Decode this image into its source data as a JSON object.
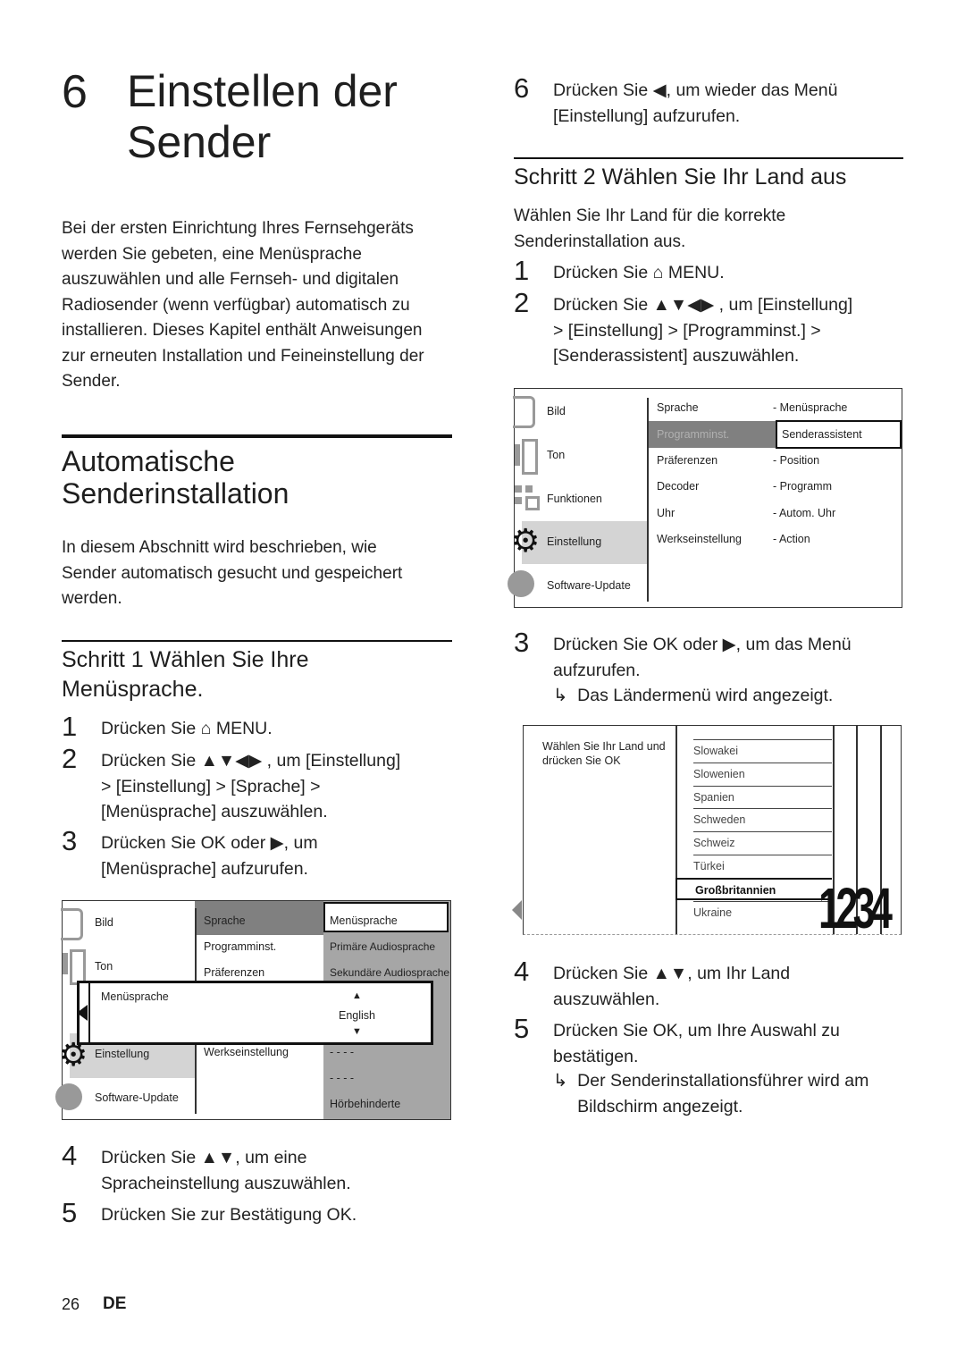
{
  "chapter": {
    "number": "6",
    "title": "Einstellen der\nSender"
  },
  "intro": "Bei der ersten Einrichtung Ihres Fernsehgeräts\nwerden Sie gebeten, eine Menüsprache\nauszuwählen und alle Fernseh- und digitalen\nRadiosender (wenn verfügbar) automatisch zu\ninstallieren. Dieses Kapitel enthält Anweisungen\nzur erneuten Installation und Feineinstellung der\nSender.",
  "section": {
    "title": "Automatische\nSenderinstallation",
    "text": "In diesem Abschnitt wird beschrieben, wie\nSender automatisch gesucht und gespeichert\nwerden."
  },
  "step1": {
    "heading": "Schritt 1 Wählen Sie Ihre\nMenüsprache.",
    "items": [
      {
        "n": "1",
        "text": "Drücken Sie ⌂ MENU."
      },
      {
        "n": "2",
        "text": "Drücken Sie ▲▼◀▶ , um [Einstellung]\n> [Einstellung] > [Sprache] >\n[Menüsprache] auszuwählen."
      },
      {
        "n": "3",
        "text": "Drücken Sie OK oder ▶, um\n[Menüsprache] aufzurufen."
      },
      {
        "n": "4",
        "text": "Drücken Sie ▲▼, um eine\nSpracheinstellung auszuwählen."
      },
      {
        "n": "5",
        "text": "Drücken Sie zur Bestätigung OK."
      }
    ]
  },
  "menu1": {
    "left": [
      "Bild",
      "Ton",
      "Einstellung",
      "Software-Update"
    ],
    "middle": [
      "Sprache",
      "Programminst.",
      "Präferenzen",
      "Werkseinstellung"
    ],
    "right": [
      "Menüsprache",
      "Primäre Audiosprache",
      "Sekundäre Audiosprache",
      "- - - -",
      "- - - -",
      "Hörbehinderte"
    ],
    "popup": {
      "label": "Menüsprache",
      "up": "▲",
      "value": "English",
      "down": "▼"
    }
  },
  "right": {
    "step6": {
      "n": "6",
      "text": "Drücken Sie ◀, um wieder das Menü\n[Einstellung] aufzurufen."
    },
    "heading": "Schritt 2 Wählen Sie Ihr Land aus",
    "text": "Wählen Sie Ihr Land für die korrekte\nSenderinstallation aus.",
    "items": [
      {
        "n": "1",
        "text": "Drücken Sie ⌂ MENU."
      },
      {
        "n": "2",
        "text": "Drücken Sie ▲▼◀▶ , um [Einstellung]\n> [Einstellung] > [Programminst.] >\n[Senderassistent] auszuwählen."
      },
      {
        "n": "3",
        "text": "Drücken Sie OK oder ▶, um das Menü\naufzurufen."
      },
      {
        "n": "4",
        "text": "Drücken Sie ▲▼, um Ihr Land\nauszuwählen."
      },
      {
        "n": "5",
        "text": "Drücken Sie OK, um Ihre Auswahl zu\nbestätigen."
      }
    ],
    "result3": "↳  Das Ländermenü wird angezeigt.",
    "result5": "↳  Der Senderinstallationsführer wird am\n     Bildschirm angezeigt."
  },
  "menu2": {
    "left": [
      "Bild",
      "Ton",
      "Funktionen",
      "Einstellung",
      "Software-Update"
    ],
    "middle": [
      "Sprache",
      "Programminst.",
      "Präferenzen",
      "Decoder",
      "Uhr",
      "Werkseinstellung"
    ],
    "right": [
      "- Menüsprache",
      "Senderassistent",
      "- Position",
      "- Programm",
      "- Autom. Uhr",
      "- Action"
    ]
  },
  "menu3": {
    "prompt": "Wählen Sie Ihr Land und\ndrücken Sie OK",
    "countries": [
      "Slowakei",
      "Slowenien",
      "Spanien",
      "Schweden",
      "Schweiz",
      "Türkei",
      "Großbritannien",
      "Ukraine"
    ],
    "selected": "Großbritannien",
    "steps_graphic": "1234"
  },
  "footer": {
    "page": "26",
    "lang": "DE"
  },
  "colors": {
    "menu_dark": "#808080",
    "menu_mid": "#a6a6a6",
    "menu_light": "#d4d4d4"
  }
}
